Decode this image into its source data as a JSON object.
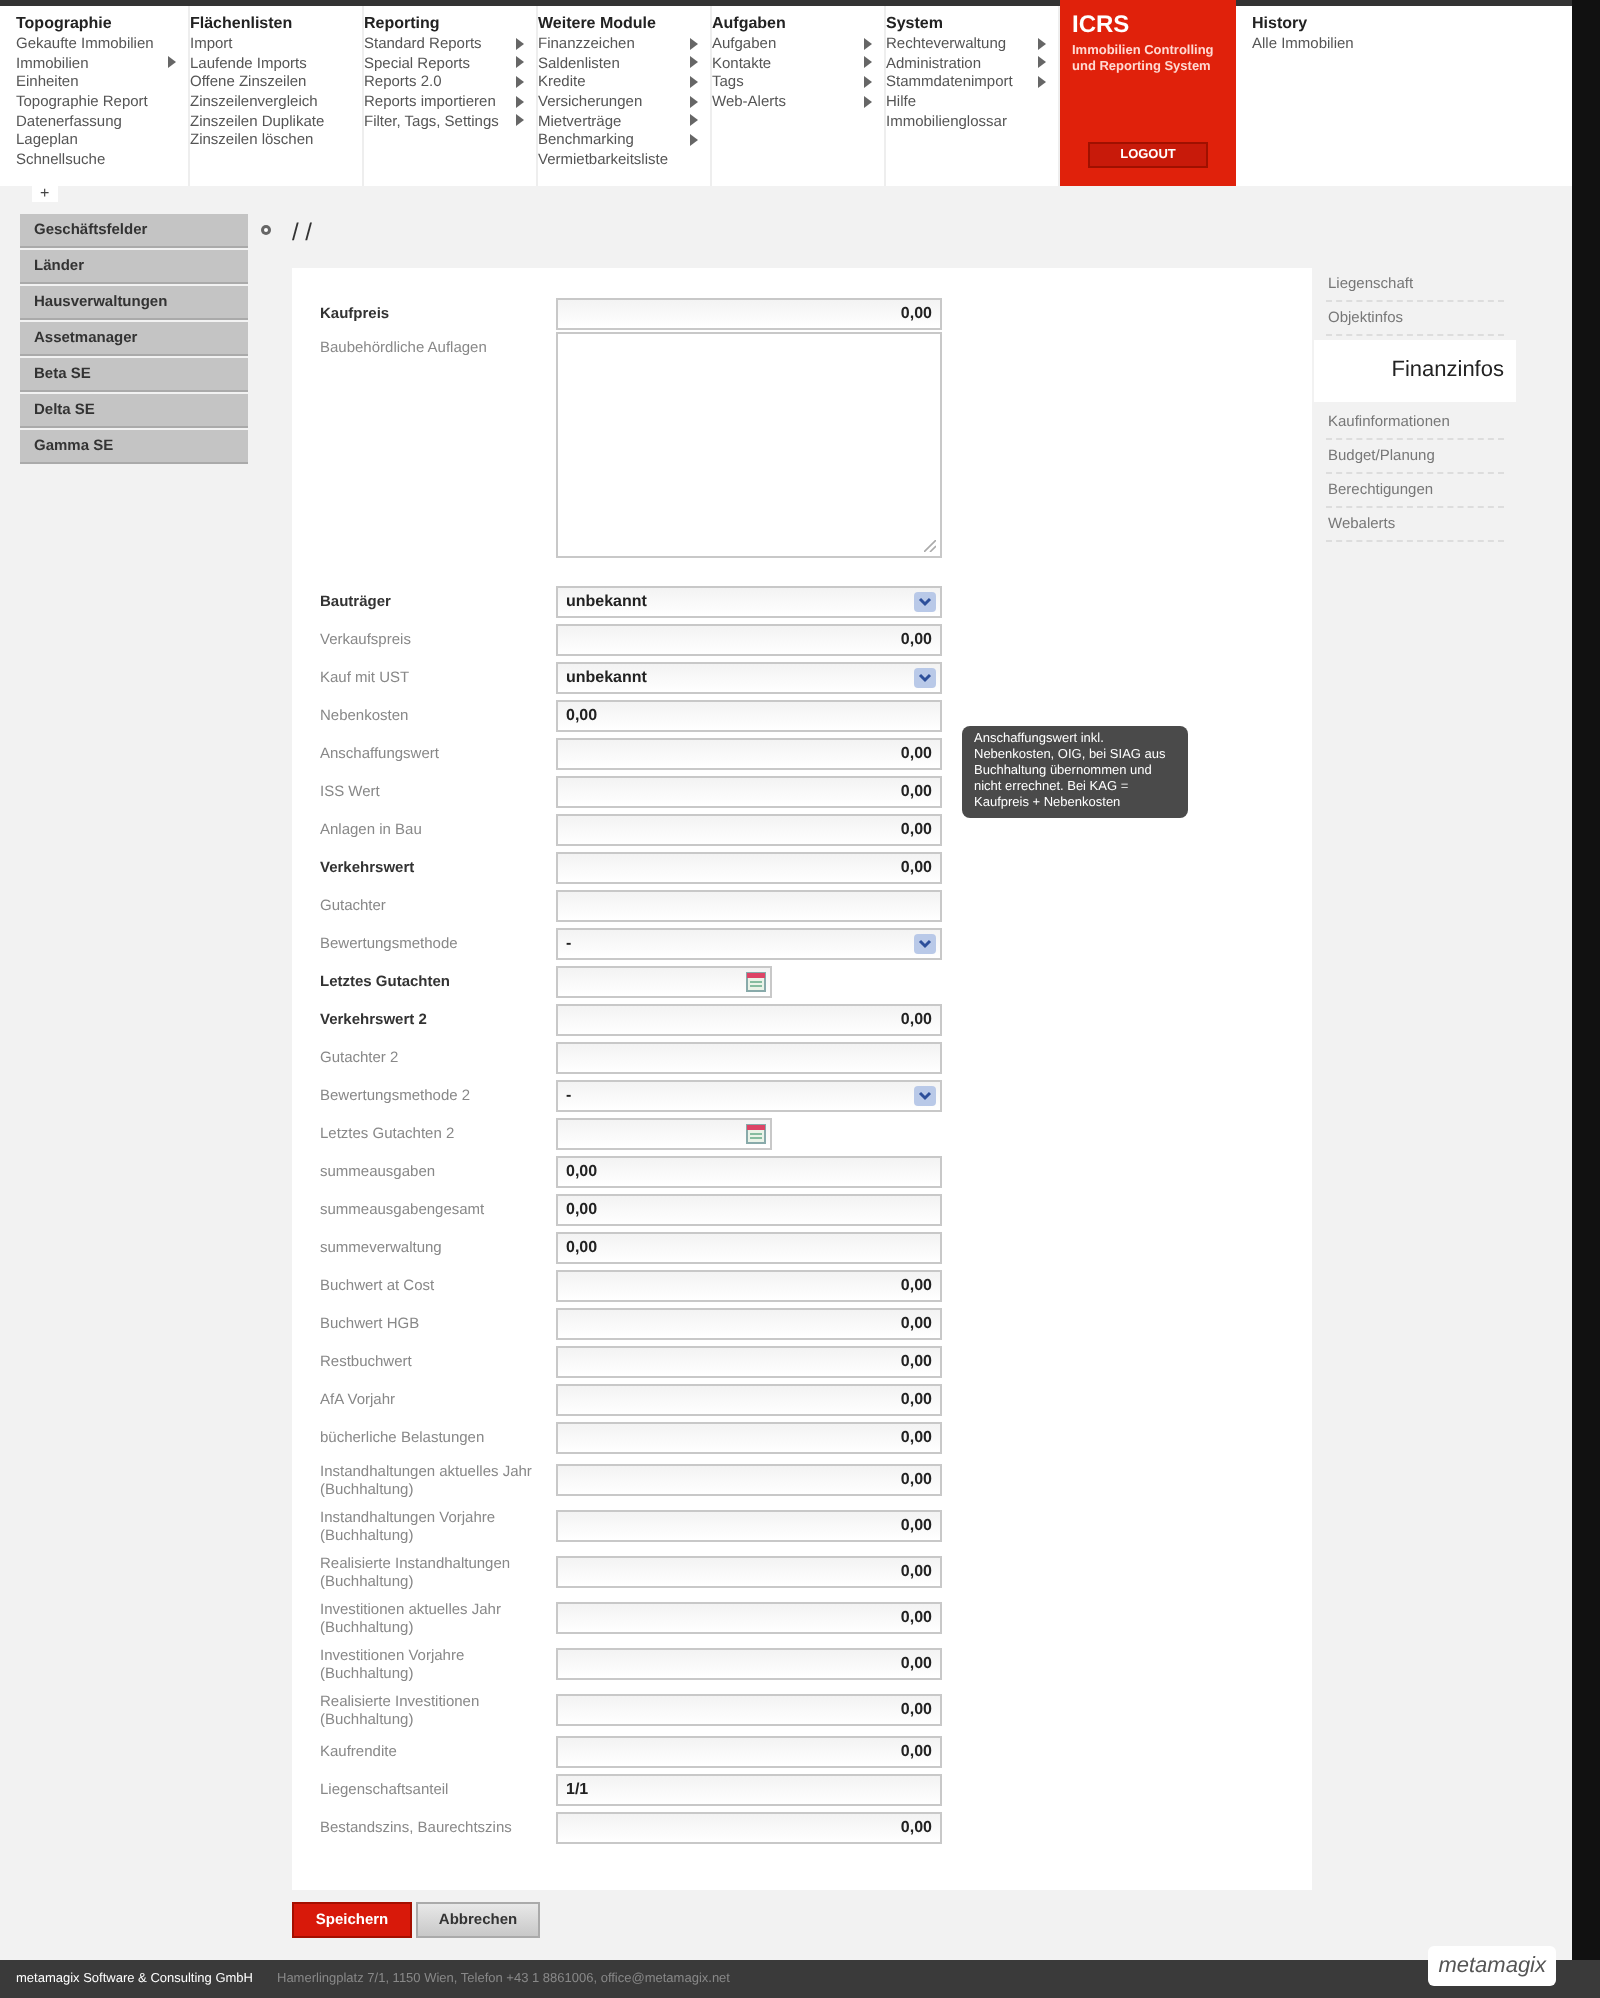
{
  "menu": [
    {
      "title": "Topographie",
      "items": [
        {
          "label": "Gekaufte Immobilien",
          "arrow": false
        },
        {
          "label": "Immobilien",
          "arrow": true
        },
        {
          "label": "Einheiten",
          "arrow": false
        },
        {
          "label": "Topographie Report",
          "arrow": false
        },
        {
          "label": "Datenerfassung",
          "arrow": false
        },
        {
          "label": "Lageplan",
          "arrow": false
        },
        {
          "label": "Schnellsuche",
          "arrow": false
        }
      ]
    },
    {
      "title": "Flächenlisten",
      "items": [
        {
          "label": "Import",
          "arrow": false
        },
        {
          "label": "Laufende Imports",
          "arrow": false
        },
        {
          "label": "Offene Zinszeilen",
          "arrow": false
        },
        {
          "label": "Zinszeilenvergleich",
          "arrow": false
        },
        {
          "label": "Zinszeilen Duplikate",
          "arrow": false
        },
        {
          "label": "Zinszeilen löschen",
          "arrow": false
        }
      ]
    },
    {
      "title": "Reporting",
      "items": [
        {
          "label": "Standard Reports",
          "arrow": true
        },
        {
          "label": "Special Reports",
          "arrow": true
        },
        {
          "label": "Reports 2.0",
          "arrow": true
        },
        {
          "label": "Reports importieren",
          "arrow": true
        },
        {
          "label": "Filter, Tags, Settings",
          "arrow": true
        }
      ]
    },
    {
      "title": "Weitere Module",
      "items": [
        {
          "label": "Finanzzeichen",
          "arrow": true
        },
        {
          "label": "Saldenlisten",
          "arrow": true
        },
        {
          "label": "Kredite",
          "arrow": true
        },
        {
          "label": "Versicherungen",
          "arrow": true
        },
        {
          "label": "Mietverträge",
          "arrow": true
        },
        {
          "label": "Benchmarking",
          "arrow": true
        },
        {
          "label": "Vermietbarkeitsliste",
          "arrow": false
        }
      ]
    },
    {
      "title": "Aufgaben",
      "items": [
        {
          "label": "Aufgaben",
          "arrow": true
        },
        {
          "label": "Kontakte",
          "arrow": true
        },
        {
          "label": "Tags",
          "arrow": true
        },
        {
          "label": "Web-Alerts",
          "arrow": true
        }
      ]
    },
    {
      "title": "System",
      "items": [
        {
          "label": "Rechteverwaltung",
          "arrow": true
        },
        {
          "label": "Administration",
          "arrow": true
        },
        {
          "label": "Stammdatenimport",
          "arrow": true
        },
        {
          "label": "Hilfe",
          "arrow": false
        },
        {
          "label": "Immobilienglossar",
          "arrow": false
        }
      ]
    }
  ],
  "brand": {
    "title": "ICRS",
    "subtitle": "Immobilien Controlling und Reporting System",
    "logout": "LOGOUT"
  },
  "history": {
    "title": "History",
    "items": [
      "Alle Immobilien"
    ]
  },
  "collapse_toggle": "+",
  "sidebar": {
    "items": [
      {
        "label": "Geschäftsfelder"
      },
      {
        "label": "Länder"
      },
      {
        "label": "Hausverwaltungen"
      },
      {
        "label": "Assetmanager"
      },
      {
        "label": "Beta SE"
      },
      {
        "label": "Delta SE"
      },
      {
        "label": "Gamma SE"
      }
    ]
  },
  "page_title": "/ /",
  "fields": [
    {
      "label": "Kaufpreis",
      "bold": true,
      "kind": "number",
      "value": "0,00"
    },
    {
      "label": "Baubehördliche Auflagen",
      "bold": false,
      "kind": "textarea"
    },
    {
      "label": "Bauträger",
      "bold": true,
      "kind": "select",
      "value": "unbekannt"
    },
    {
      "label": "Verkaufspreis",
      "bold": false,
      "kind": "number",
      "value": "0,00"
    },
    {
      "label": "Kauf mit UST",
      "bold": false,
      "kind": "select",
      "value": "unbekannt"
    },
    {
      "label": "Nebenkosten",
      "bold": false,
      "kind": "text",
      "value": "0,00"
    },
    {
      "label": "Anschaffungswert",
      "bold": false,
      "kind": "number",
      "value": "0,00",
      "tooltip": "Anschaffungswert inkl. Nebenkosten, OIG, bei SIAG aus Buchhaltung übernommen und nicht errechnet. Bei KAG = Kaufpreis + Nebenkosten"
    },
    {
      "label": "ISS Wert",
      "bold": false,
      "kind": "number",
      "value": "0,00"
    },
    {
      "label": "Anlagen in Bau",
      "bold": false,
      "kind": "number",
      "value": "0,00"
    },
    {
      "label": "Verkehrswert",
      "bold": true,
      "kind": "number",
      "value": "0,00"
    },
    {
      "label": "Gutachter",
      "bold": false,
      "kind": "text"
    },
    {
      "label": "Bewertungsmethode",
      "bold": false,
      "kind": "select",
      "value": "-"
    },
    {
      "label": "Letztes Gutachten",
      "bold": true,
      "kind": "date"
    },
    {
      "label": "Verkehrswert 2",
      "bold": true,
      "kind": "number",
      "value": "0,00"
    },
    {
      "label": "Gutachter 2",
      "bold": false,
      "kind": "text"
    },
    {
      "label": "Bewertungsmethode 2",
      "bold": false,
      "kind": "select",
      "value": "-"
    },
    {
      "label": "Letztes Gutachten 2",
      "bold": false,
      "kind": "date"
    },
    {
      "label": "summeausgaben",
      "bold": false,
      "kind": "text",
      "value": "0,00"
    },
    {
      "label": "summeausgabengesamt",
      "bold": false,
      "kind": "text",
      "value": "0,00"
    },
    {
      "label": "summeverwaltung",
      "bold": false,
      "kind": "text",
      "value": "0,00"
    },
    {
      "label": "Buchwert at Cost",
      "bold": false,
      "kind": "number",
      "value": "0,00"
    },
    {
      "label": "Buchwert HGB",
      "bold": false,
      "kind": "number",
      "value": "0,00"
    },
    {
      "label": "Restbuchwert",
      "bold": false,
      "kind": "number",
      "value": "0,00"
    },
    {
      "label": "AfA Vorjahr",
      "bold": false,
      "kind": "number",
      "value": "0,00"
    },
    {
      "label": "bücherliche Belastungen",
      "bold": false,
      "kind": "number",
      "value": "0,00"
    },
    {
      "label": "Instandhaltungen aktuelles Jahr (Buchhaltung)",
      "bold": false,
      "kind": "number",
      "value": "0,00"
    },
    {
      "label": "Instandhaltungen Vorjahre (Buchhaltung)",
      "bold": false,
      "kind": "number",
      "value": "0,00"
    },
    {
      "label": "Realisierte Instandhaltungen (Buchhaltung)",
      "bold": false,
      "kind": "number",
      "value": "0,00"
    },
    {
      "label": "Investitionen aktuelles Jahr (Buchhaltung)",
      "bold": false,
      "kind": "number",
      "value": "0,00"
    },
    {
      "label": "Investitionen Vorjahre (Buchhaltung)",
      "bold": false,
      "kind": "number",
      "value": "0,00"
    },
    {
      "label": "Realisierte Investitionen (Buchhaltung)",
      "bold": false,
      "kind": "number",
      "value": "0,00"
    },
    {
      "label": "Kaufrendite",
      "bold": false,
      "kind": "number",
      "value": "0,00"
    },
    {
      "label": "Liegenschaftsanteil",
      "bold": false,
      "kind": "text",
      "value": "1/1"
    },
    {
      "label": "Bestandszins, Baurechtszins",
      "bold": false,
      "kind": "number",
      "value": "0,00"
    }
  ],
  "buttons": {
    "save": "Speichern",
    "cancel": "Abbrechen"
  },
  "tabs": [
    {
      "label": "Liegenschaft",
      "selected": false
    },
    {
      "label": "Objektinfos",
      "selected": false
    },
    {
      "label": "Finanzinfos",
      "selected": true
    },
    {
      "label": "Kaufinformationen",
      "selected": false
    },
    {
      "label": "Budget/Planung",
      "selected": false
    },
    {
      "label": "Berechtigungen",
      "selected": false
    },
    {
      "label": "Webalerts",
      "selected": false
    }
  ],
  "footer": {
    "company": "metamagix Software & Consulting GmbH",
    "address": "Hamerlingplatz 7/1, 1150 Wien, Telefon +43 1 8861006, office@metamagix.net",
    "logo": "metamagix"
  }
}
